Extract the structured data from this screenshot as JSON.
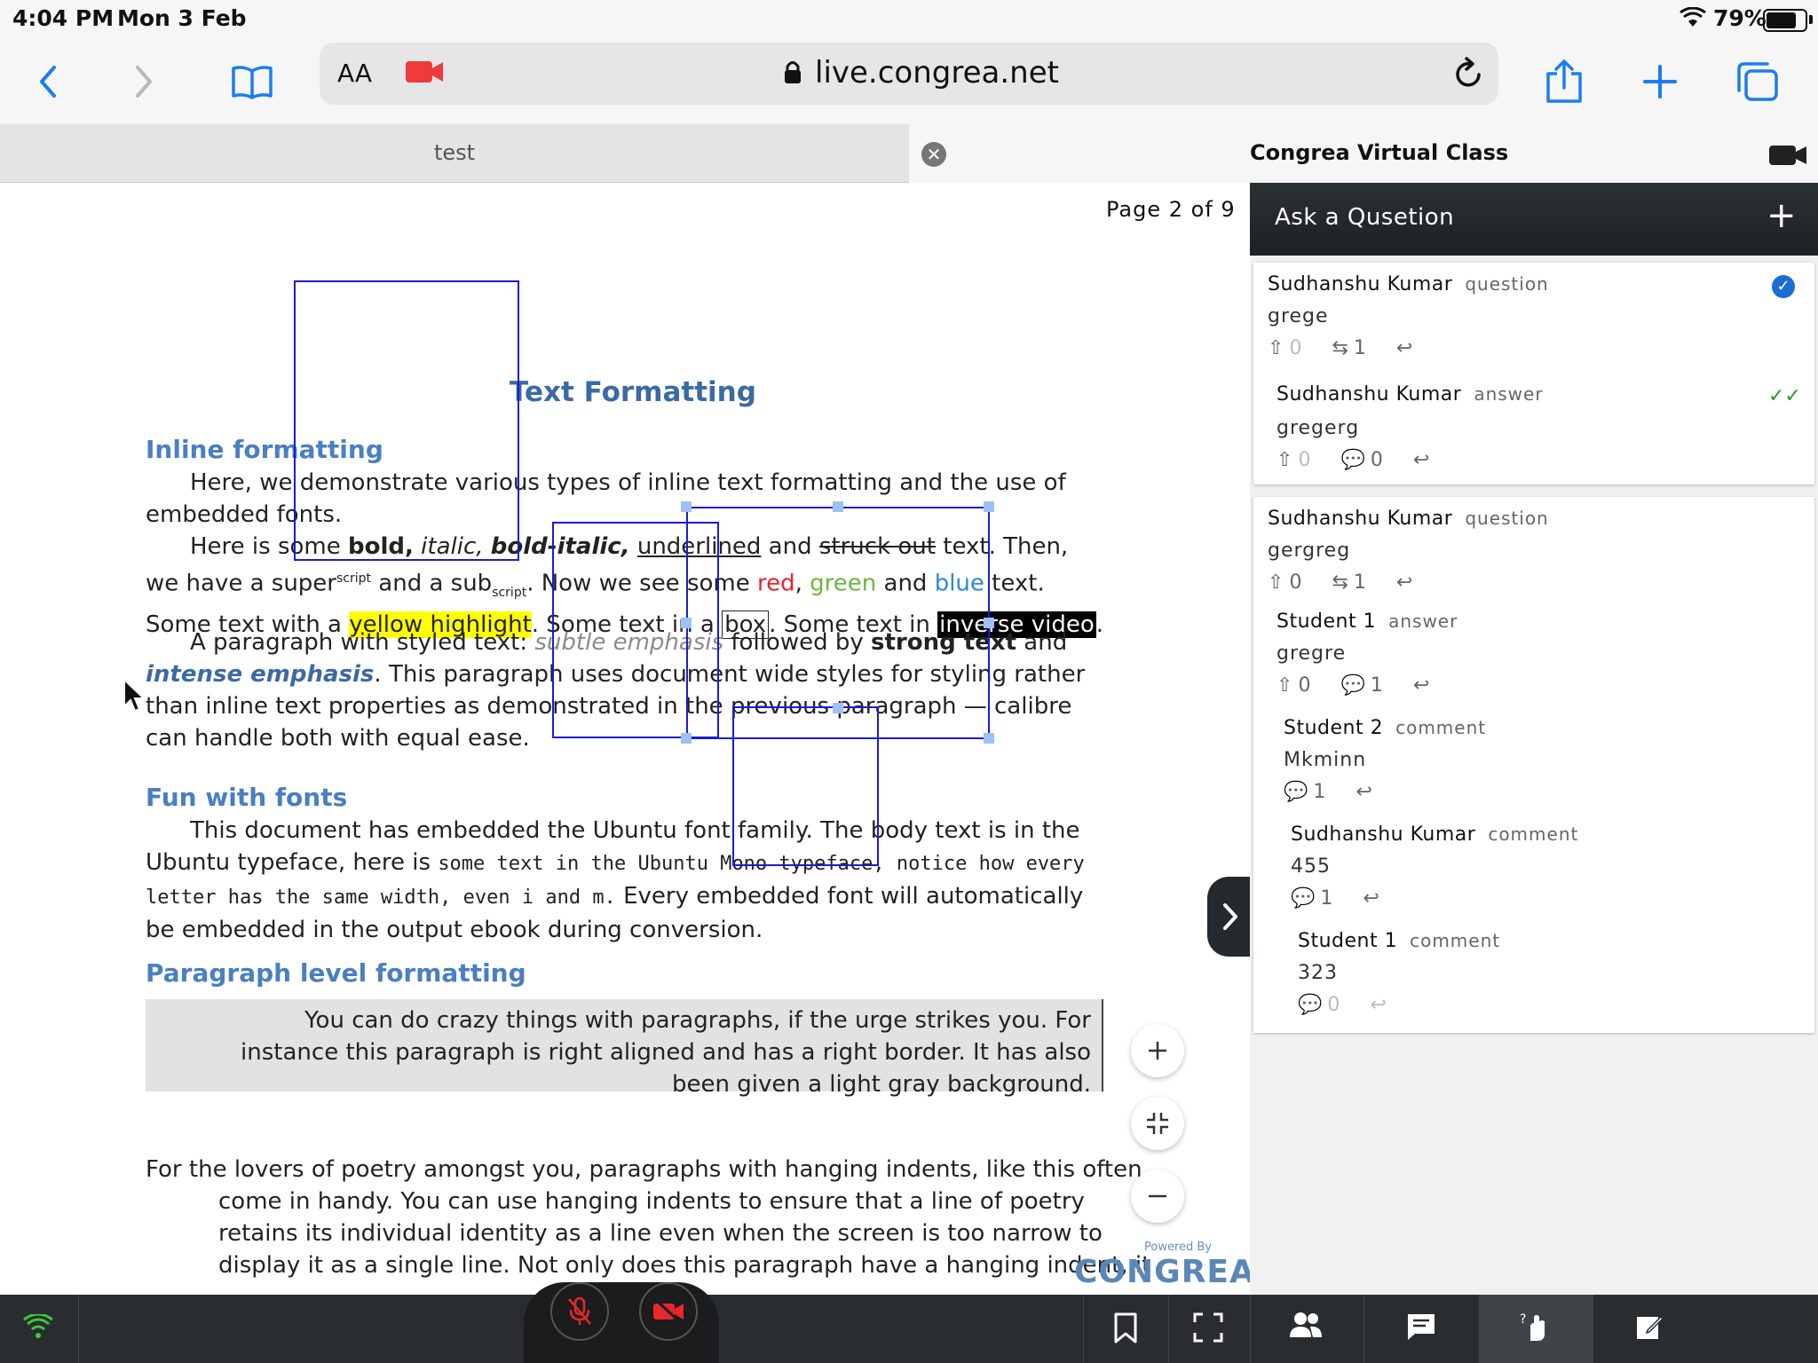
{
  "status_bar": {
    "time": "4:04 PM",
    "date": "Mon 3 Feb",
    "battery": "79%",
    "battery_level": 0.79
  },
  "browser": {
    "text_size_label": "AA",
    "url": "live.congrea.net"
  },
  "tabs": [
    {
      "label": "test",
      "active": false
    },
    {
      "label": "Congrea Virtual Class",
      "active": true
    }
  ],
  "document": {
    "page_indicator": "Page  2 of 9",
    "title": "Text Formatting",
    "section1_heading": "Inline formatting",
    "p1": "Here, we demonstrate various types of inline text formatting and the use of embedded fonts.",
    "p2": {
      "a": "Here is some ",
      "bold": "bold,",
      "italic": "italic,",
      "bolditalic": "bold-italic,",
      "underlined": "underlined",
      "b": " and ",
      "struck": "struck out",
      "c": " text. Then, we have a super",
      "sup": "script",
      "d": " and a sub",
      "sub": "script",
      "e": ". Now we see some ",
      "red": "red",
      "f": ", ",
      "green": "green",
      "g": " and ",
      "blue": "blue",
      "h": " text. Some text with a ",
      "highlight": "yellow highlight",
      "i": ". Some text in a ",
      "box": "box",
      "j": ". Some text in ",
      "inverse": "inverse video",
      "k": "."
    },
    "p3": {
      "a": "A paragraph with styled text: ",
      "subtle": "subtle emphasis",
      "b": " followed by ",
      "strong": "strong text",
      "c": " and ",
      "intense": "intense emphasis",
      "d": ". This paragraph uses document wide styles for styling rather than inline text properties as demonstrated in the previous paragraph — calibre can handle both with equal ease."
    },
    "section2_heading": "Fun with fonts",
    "p4": {
      "a": "This document has embedded the Ubuntu font family. The body text is in the Ubuntu typeface, here is ",
      "mono": "some text in the Ubuntu Mono typeface, notice how every letter has the same width, even i and m.",
      "b": " Every embedded font will automatically be embedded in the output ebook during conversion."
    },
    "section3_heading": "Paragraph level formatting",
    "p5": "You can do crazy things with paragraphs, if the urge strikes you. For instance this paragraph is right aligned and has a right border. It has also been given a light gray background.",
    "p6": "For the lovers of poetry amongst you, paragraphs with hanging indents, like this often come in handy. You can use hanging indents to ensure that a line of poetry retains its individual identity as a line even when the screen is  too narrow to display it as a single line. Not only does this paragraph have a hanging indent, it"
  },
  "branding": {
    "powered_by": "Powered By",
    "logo": "CONGREA"
  },
  "qa_panel": {
    "header": "Ask a Qusetion",
    "threads": [
      {
        "author": "Sudhanshu Kumar",
        "type": "question",
        "text": "grege",
        "upvotes": "0",
        "count": "1",
        "resolved": true,
        "replies": [
          {
            "author": "Sudhanshu Kumar",
            "type": "answer",
            "text": "gregerg",
            "upvotes": "0",
            "comments": "0"
          }
        ]
      },
      {
        "author": "Sudhanshu Kumar",
        "type": "question",
        "text": "gergreg",
        "upvotes": "0",
        "count": "1",
        "replies": [
          {
            "author": "Student 1",
            "type": "answer",
            "text": "gregre",
            "upvotes": "0",
            "comments": "1"
          },
          {
            "author": "Student 2",
            "type": "comment",
            "text": "Mkminn",
            "comments": "1"
          },
          {
            "author": "Sudhanshu Kumar",
            "type": "comment",
            "text": "455",
            "comments": "1"
          },
          {
            "author": "Student 1",
            "type": "comment",
            "text": "323",
            "comments": "0"
          }
        ]
      }
    ]
  },
  "colors": {
    "accent": "#1c6cd8",
    "annotation": "#1a1adb",
    "heading": "#3b6aa3",
    "muted_red": "#e8262b",
    "raise_hand_active": "#3f4448"
  },
  "icons": [
    "wifi-icon",
    "back-icon",
    "forward-icon",
    "bookmarks-icon",
    "camera-icon",
    "lock-icon",
    "reload-icon",
    "share-icon",
    "plus-icon",
    "tabs-icon",
    "mic-off-icon",
    "video-off-icon",
    "bookmark-icon",
    "fullscreen-icon",
    "users-icon",
    "chat-icon",
    "raise-hand-icon",
    "notes-icon"
  ]
}
